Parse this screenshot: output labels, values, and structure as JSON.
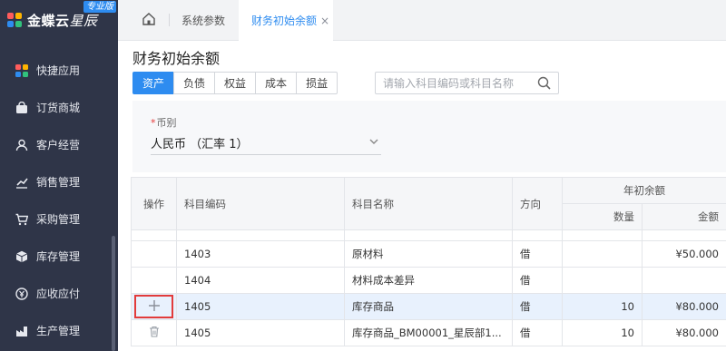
{
  "brand": {
    "name": "金蝶云",
    "sub": "星辰",
    "edition": "专业版"
  },
  "sidebar": {
    "items": [
      {
        "label": "快捷应用",
        "icon": "grid-apps-icon"
      },
      {
        "label": "订货商城",
        "icon": "shopping-bag-icon"
      },
      {
        "label": "客户经营",
        "icon": "customer-icon"
      },
      {
        "label": "销售管理",
        "icon": "sales-chart-icon"
      },
      {
        "label": "采购管理",
        "icon": "cart-icon"
      },
      {
        "label": "库存管理",
        "icon": "box-icon"
      },
      {
        "label": "应收应付",
        "icon": "money-icon"
      },
      {
        "label": "生产管理",
        "icon": "production-icon"
      }
    ]
  },
  "tabs": {
    "home_icon": "home-icon",
    "items": [
      {
        "label": "系统参数"
      },
      {
        "label": "财务初始余额",
        "close": "×"
      }
    ]
  },
  "page": {
    "title": "财务初始余额",
    "category_tabs": [
      "资产",
      "负债",
      "权益",
      "成本",
      "损益"
    ],
    "search_placeholder": "请输入科目编码或科目名称",
    "currency_label": "币别",
    "currency_required": "*",
    "currency_value": "人民币 （汇率 1）"
  },
  "table": {
    "headers": {
      "op": "操作",
      "code": "科目编码",
      "name": "科目名称",
      "dir": "方向",
      "group": "年初余额",
      "qty": "数量",
      "amount": "金额"
    },
    "rows": [
      {
        "code": "1403",
        "name": "原材料",
        "dir": "借",
        "qty": "",
        "amount": "¥50.000"
      },
      {
        "code": "1404",
        "name": "材料成本差异",
        "dir": "借",
        "qty": "",
        "amount": ""
      },
      {
        "code": "1405",
        "name": "库存商品",
        "dir": "借",
        "qty": "10",
        "amount": "¥80.000"
      },
      {
        "code": "1405",
        "name": "库存商品_BM00001_星辰部1...",
        "dir": "借",
        "qty": "10",
        "amount": "¥80.000"
      }
    ]
  },
  "colors": {
    "accent": "#2e8cf0",
    "sidebar": "#2f3548",
    "highlight_border": "#e23b3b"
  }
}
